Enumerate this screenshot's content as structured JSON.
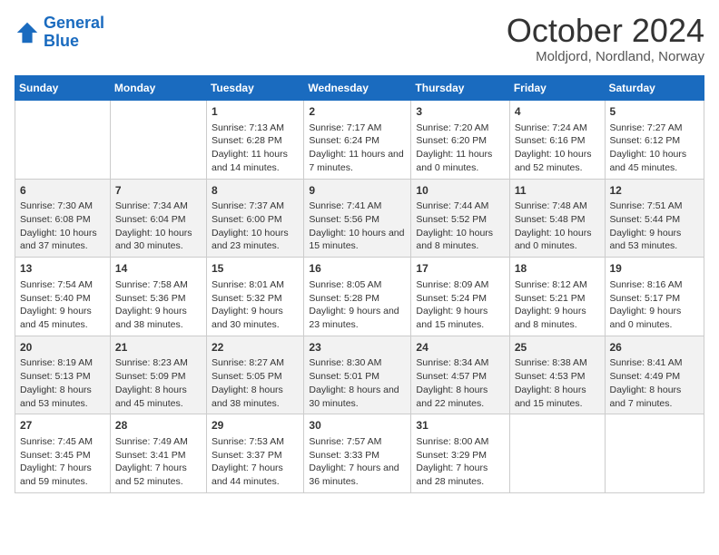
{
  "header": {
    "logo_line1": "General",
    "logo_line2": "Blue",
    "month": "October 2024",
    "location": "Moldjord, Nordland, Norway"
  },
  "weekdays": [
    "Sunday",
    "Monday",
    "Tuesday",
    "Wednesday",
    "Thursday",
    "Friday",
    "Saturday"
  ],
  "weeks": [
    [
      {
        "day": "",
        "info": ""
      },
      {
        "day": "",
        "info": ""
      },
      {
        "day": "1",
        "info": "Sunrise: 7:13 AM\nSunset: 6:28 PM\nDaylight: 11 hours and 14 minutes."
      },
      {
        "day": "2",
        "info": "Sunrise: 7:17 AM\nSunset: 6:24 PM\nDaylight: 11 hours and 7 minutes."
      },
      {
        "day": "3",
        "info": "Sunrise: 7:20 AM\nSunset: 6:20 PM\nDaylight: 11 hours and 0 minutes."
      },
      {
        "day": "4",
        "info": "Sunrise: 7:24 AM\nSunset: 6:16 PM\nDaylight: 10 hours and 52 minutes."
      },
      {
        "day": "5",
        "info": "Sunrise: 7:27 AM\nSunset: 6:12 PM\nDaylight: 10 hours and 45 minutes."
      }
    ],
    [
      {
        "day": "6",
        "info": "Sunrise: 7:30 AM\nSunset: 6:08 PM\nDaylight: 10 hours and 37 minutes."
      },
      {
        "day": "7",
        "info": "Sunrise: 7:34 AM\nSunset: 6:04 PM\nDaylight: 10 hours and 30 minutes."
      },
      {
        "day": "8",
        "info": "Sunrise: 7:37 AM\nSunset: 6:00 PM\nDaylight: 10 hours and 23 minutes."
      },
      {
        "day": "9",
        "info": "Sunrise: 7:41 AM\nSunset: 5:56 PM\nDaylight: 10 hours and 15 minutes."
      },
      {
        "day": "10",
        "info": "Sunrise: 7:44 AM\nSunset: 5:52 PM\nDaylight: 10 hours and 8 minutes."
      },
      {
        "day": "11",
        "info": "Sunrise: 7:48 AM\nSunset: 5:48 PM\nDaylight: 10 hours and 0 minutes."
      },
      {
        "day": "12",
        "info": "Sunrise: 7:51 AM\nSunset: 5:44 PM\nDaylight: 9 hours and 53 minutes."
      }
    ],
    [
      {
        "day": "13",
        "info": "Sunrise: 7:54 AM\nSunset: 5:40 PM\nDaylight: 9 hours and 45 minutes."
      },
      {
        "day": "14",
        "info": "Sunrise: 7:58 AM\nSunset: 5:36 PM\nDaylight: 9 hours and 38 minutes."
      },
      {
        "day": "15",
        "info": "Sunrise: 8:01 AM\nSunset: 5:32 PM\nDaylight: 9 hours and 30 minutes."
      },
      {
        "day": "16",
        "info": "Sunrise: 8:05 AM\nSunset: 5:28 PM\nDaylight: 9 hours and 23 minutes."
      },
      {
        "day": "17",
        "info": "Sunrise: 8:09 AM\nSunset: 5:24 PM\nDaylight: 9 hours and 15 minutes."
      },
      {
        "day": "18",
        "info": "Sunrise: 8:12 AM\nSunset: 5:21 PM\nDaylight: 9 hours and 8 minutes."
      },
      {
        "day": "19",
        "info": "Sunrise: 8:16 AM\nSunset: 5:17 PM\nDaylight: 9 hours and 0 minutes."
      }
    ],
    [
      {
        "day": "20",
        "info": "Sunrise: 8:19 AM\nSunset: 5:13 PM\nDaylight: 8 hours and 53 minutes."
      },
      {
        "day": "21",
        "info": "Sunrise: 8:23 AM\nSunset: 5:09 PM\nDaylight: 8 hours and 45 minutes."
      },
      {
        "day": "22",
        "info": "Sunrise: 8:27 AM\nSunset: 5:05 PM\nDaylight: 8 hours and 38 minutes."
      },
      {
        "day": "23",
        "info": "Sunrise: 8:30 AM\nSunset: 5:01 PM\nDaylight: 8 hours and 30 minutes."
      },
      {
        "day": "24",
        "info": "Sunrise: 8:34 AM\nSunset: 4:57 PM\nDaylight: 8 hours and 22 minutes."
      },
      {
        "day": "25",
        "info": "Sunrise: 8:38 AM\nSunset: 4:53 PM\nDaylight: 8 hours and 15 minutes."
      },
      {
        "day": "26",
        "info": "Sunrise: 8:41 AM\nSunset: 4:49 PM\nDaylight: 8 hours and 7 minutes."
      }
    ],
    [
      {
        "day": "27",
        "info": "Sunrise: 7:45 AM\nSunset: 3:45 PM\nDaylight: 7 hours and 59 minutes."
      },
      {
        "day": "28",
        "info": "Sunrise: 7:49 AM\nSunset: 3:41 PM\nDaylight: 7 hours and 52 minutes."
      },
      {
        "day": "29",
        "info": "Sunrise: 7:53 AM\nSunset: 3:37 PM\nDaylight: 7 hours and 44 minutes."
      },
      {
        "day": "30",
        "info": "Sunrise: 7:57 AM\nSunset: 3:33 PM\nDaylight: 7 hours and 36 minutes."
      },
      {
        "day": "31",
        "info": "Sunrise: 8:00 AM\nSunset: 3:29 PM\nDaylight: 7 hours and 28 minutes."
      },
      {
        "day": "",
        "info": ""
      },
      {
        "day": "",
        "info": ""
      }
    ]
  ]
}
